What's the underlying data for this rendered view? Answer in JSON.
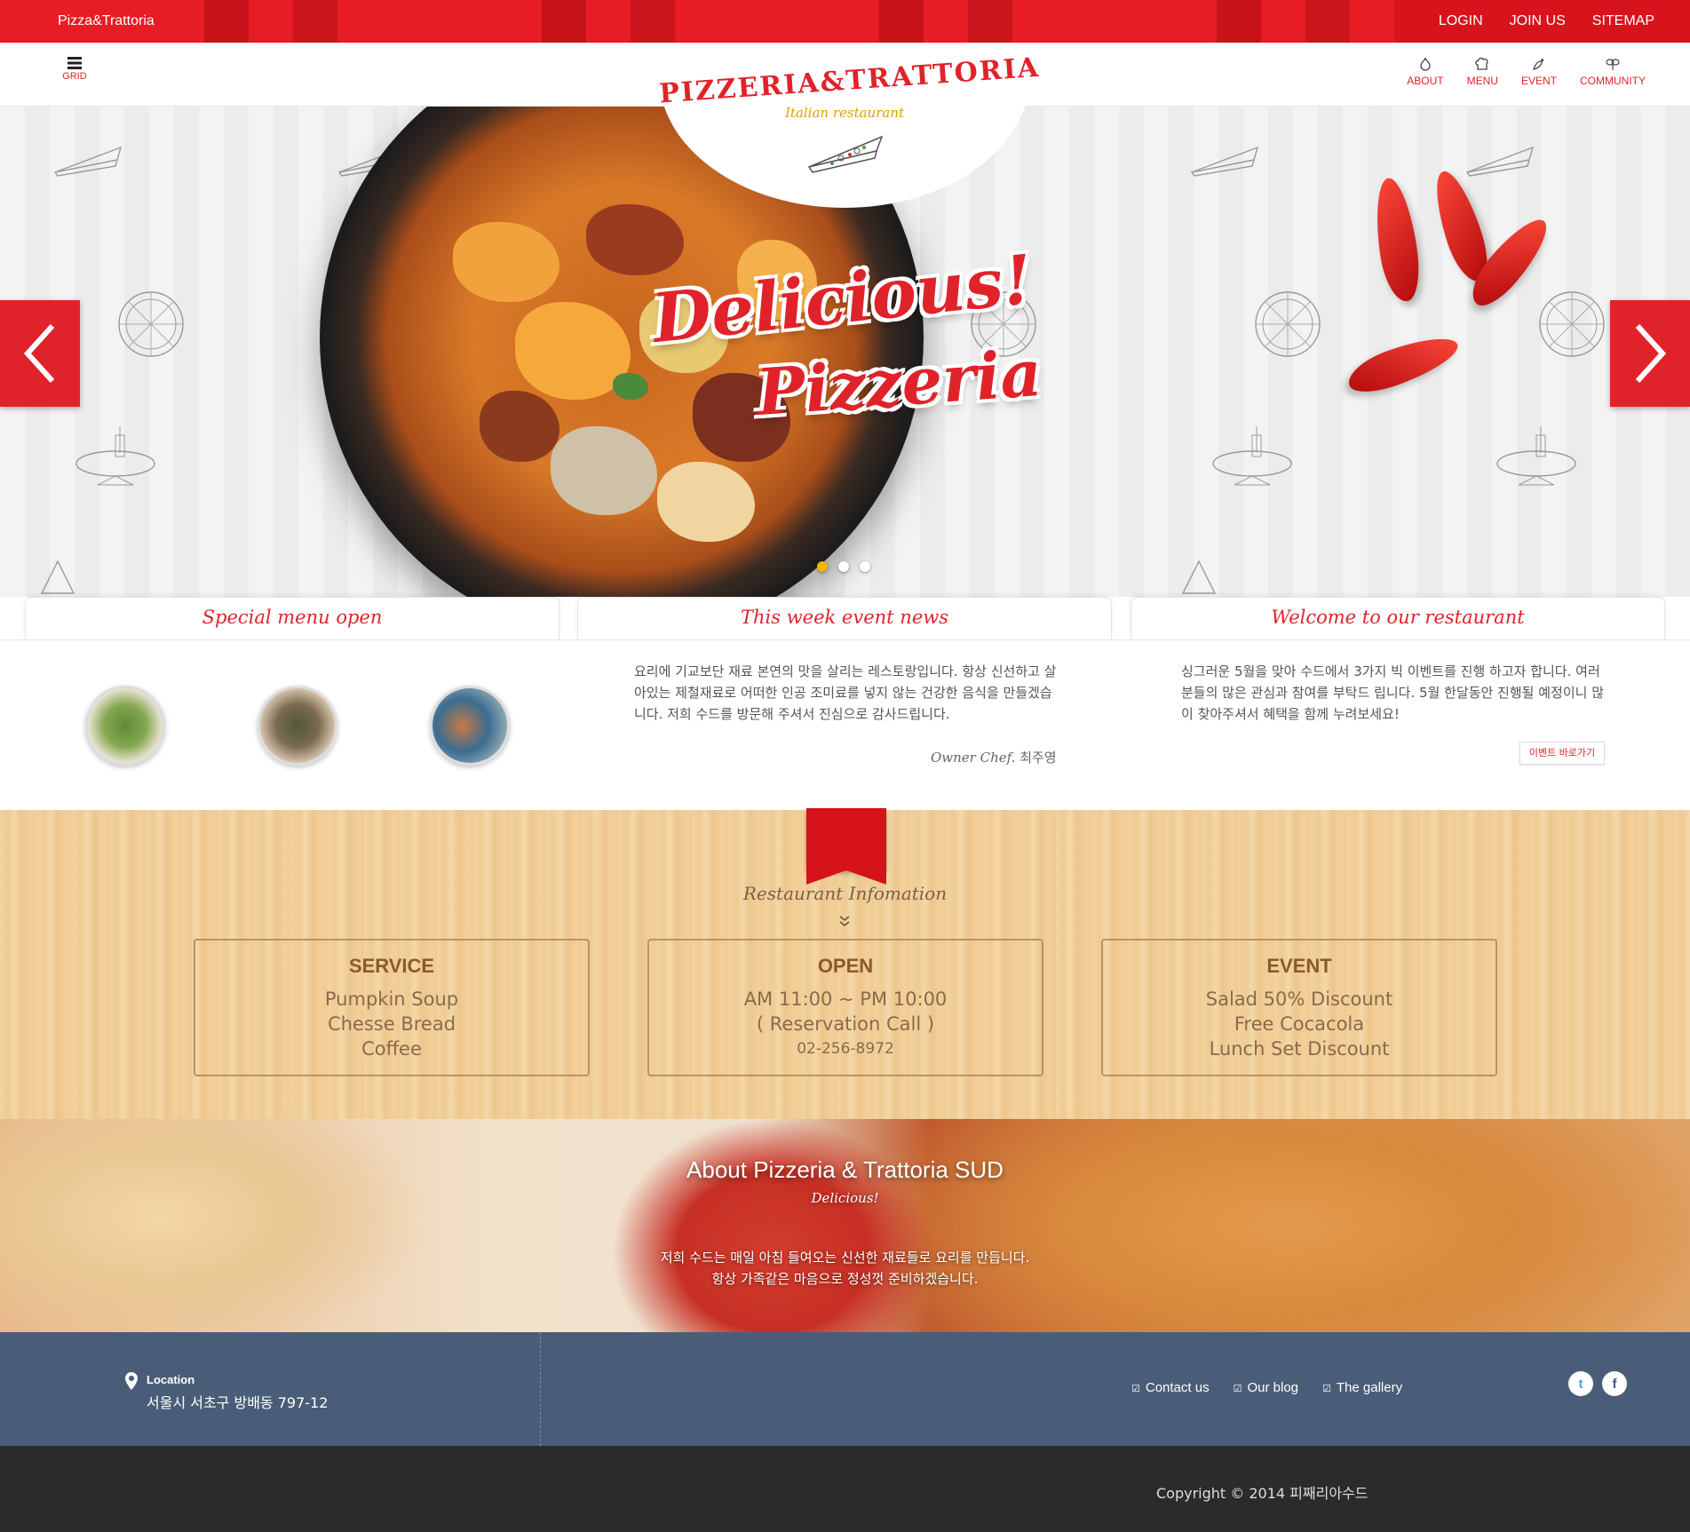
{
  "topbar": {
    "brand": "Pizza&Trattoria",
    "links": [
      "LOGIN",
      "JOIN US",
      "SITEMAP"
    ]
  },
  "header": {
    "grid_label": "GRID",
    "nav": [
      {
        "label": "ABOUT",
        "icon": "garlic-icon"
      },
      {
        "label": "MENU",
        "icon": "chef-hat-icon"
      },
      {
        "label": "EVENT",
        "icon": "pepper-icon"
      },
      {
        "label": "COMMUNITY",
        "icon": "leaves-icon"
      }
    ]
  },
  "logo": {
    "name": "PIZZERIA&TRATTORIA",
    "tagline": "Italian restaurant"
  },
  "hero": {
    "title_line1": "Delicious!",
    "title_line2": "Pizzeria",
    "slides": 3,
    "active_slide": 1
  },
  "cards": {
    "special": {
      "title": "Special menu open"
    },
    "news": {
      "title": "This week event news",
      "body": "요리에 기교보단 재료 본연의 맛을 살리는 레스토랑입니다. 항상 신선하고 살아있는 제철재료로 어떠한 인공 조미료를 넣지 않는 건강한 음식을 만들겠습니다. 저희 수드를 방문해 주셔서 진심으로 감사드립니다.",
      "owner_role": "Owner Chef.",
      "owner_name": "최주영"
    },
    "welcome": {
      "title": "Welcome to our restaurant",
      "body": "싱그러운 5월을 맞아 수드에서 3가지 빅 이벤트를 진행 하고자 합니다. 여러분들의 많은 관심과 참여를 부탁드 립니다. 5월 한달동안 진행될 예정이니 많이 찾아주셔서 혜택을 함께 누려보세요!",
      "button": "이벤트 바로가기"
    }
  },
  "info": {
    "title": "Restaurant Infomation",
    "boxes": [
      {
        "heading": "SERVICE",
        "lines": [
          "Pumpkin Soup",
          "Chesse Bread",
          "Coffee"
        ]
      },
      {
        "heading": "OPEN",
        "lines": [
          "AM 11:00 ~ PM 10:00",
          "( Reservation Call )",
          "02-256-8972"
        ]
      },
      {
        "heading": "EVENT",
        "lines": [
          "Salad 50% Discount",
          "Free Cocacola",
          "Lunch Set Discount"
        ]
      }
    ]
  },
  "about": {
    "title": "About Pizzeria & Trattoria SUD",
    "subtitle": "Delicious!",
    "line1": "저희 수드는 매일 아침 들여오는 신선한 재료들로 요리를 만듭니다.",
    "line2": "항상 가족같은 마음으로 정성껏 준비하겠습니다."
  },
  "footer": {
    "location_label": "Location",
    "address": "서울시 서초구 방배동 797-12",
    "links": [
      "Contact us",
      "Our blog",
      "The gallery"
    ],
    "social": [
      "twitter-icon",
      "facebook-icon"
    ],
    "copyright": "Copyright © 2014 피째리아수드"
  },
  "colors": {
    "brand_red": "#e0232a",
    "wood": "#f1cf98",
    "footer_blue": "#4a5d78",
    "copyright_bg": "#2b2b2b"
  }
}
